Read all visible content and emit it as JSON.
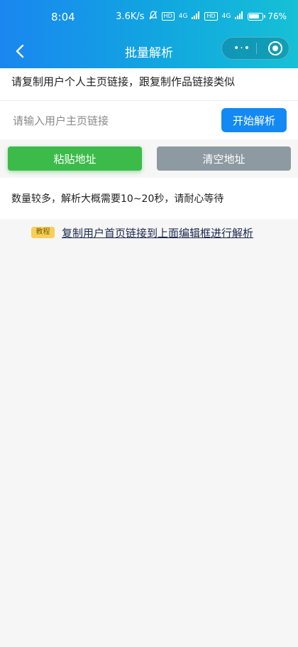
{
  "status_bar": {
    "time": "8:04",
    "net_speed": "3.6K/s",
    "hd_badge_1": "HD",
    "sig_1": "4G",
    "hd_badge_2": "HD",
    "sig_2": "4G",
    "battery_pct": "76%"
  },
  "nav": {
    "title": "批量解析",
    "more_glyph": "•·•"
  },
  "hint": "请复制用户个人主页链接，跟复制作品链接类似",
  "input": {
    "placeholder": "请输入用户主页链接",
    "value": ""
  },
  "buttons": {
    "start": "开始解析",
    "paste": "粘贴地址",
    "clear": "清空地址"
  },
  "notice": "数量较多，解析大概需要10~20秒，请耐心等待",
  "tutorial": {
    "tag": "教程",
    "link": "复制用户首页链接到上面编辑框进行解析"
  },
  "colors": {
    "header_start": "#1a86f0",
    "header_end": "#16c0d6",
    "primary": "#1389f3",
    "success": "#3cbb4a",
    "gray": "#8d9aa1",
    "tag": "#f7cf5a"
  }
}
